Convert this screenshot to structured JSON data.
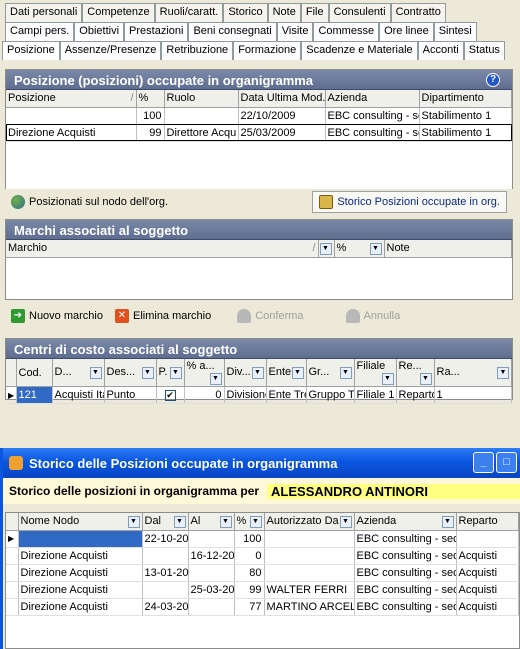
{
  "tabs": {
    "row1": [
      "Dati personali",
      "Competenze",
      "Ruoli/caratt.",
      "Storico",
      "Note",
      "File",
      "Consulenti",
      "Contratto"
    ],
    "row2": [
      "Campi pers.",
      "Obiettivi",
      "Prestazioni",
      "Beni consegnati",
      "Visite",
      "Commesse",
      "Ore linee",
      "Sintesi"
    ],
    "row3": [
      "Posizione",
      "Assenze/Presenze",
      "Retribuzione",
      "Formazione",
      "Scadenze e Materiale",
      "Acconti",
      "Status"
    ]
  },
  "positions": {
    "title": "Posizione (posizioni) occupate in organigramma",
    "help_icon": "question-icon",
    "columns": [
      "Posizione",
      "%",
      "Ruolo",
      "Data Ultima Mod.",
      "Azienda",
      "Dipartimento"
    ],
    "rows": [
      [
        "",
        "100",
        "",
        "22/10/2009",
        "EBC consulting - se",
        "Stabilimento 1"
      ],
      [
        "Direzione Acquisti",
        "99",
        "Direttore Acqu",
        "25/03/2009",
        "EBC consulting - se",
        "Stabilimento 1"
      ]
    ],
    "btn_position": "Posizionati sul nodo dell'org.",
    "btn_history": "Storico Posizioni occupate in org."
  },
  "brands": {
    "title": "Marchi associati al soggetto",
    "columns": [
      "Marchio",
      "%",
      "Note"
    ],
    "btn_new": "Nuovo marchio",
    "btn_delete": "Elimina marchio",
    "btn_confirm": "Conferma",
    "btn_cancel": "Annulla"
  },
  "costcenters": {
    "title": "Centri di costo associati al soggetto",
    "columns": [
      "Cod.",
      "D...",
      "Des...",
      "P.",
      "% a...",
      "Div...",
      "Ente",
      "Gr...",
      "Filiale",
      "Re...",
      "Ra..."
    ],
    "row": [
      "121",
      "Acquisti Ita",
      "Punto",
      "",
      "0",
      "Divisione",
      "Ente Tre",
      "Gruppo T",
      "Filiale 1",
      "Reparto '",
      "1"
    ]
  },
  "history_window": {
    "title": "Storico delle Posizioni occupate in organigramma",
    "label": "Storico delle posizioni in organigramma per",
    "person": "ALESSANDRO ANTINORI",
    "columns": [
      "Nome Nodo",
      "Dal",
      "Al",
      "%",
      "Autorizzato Da",
      "Azienda",
      "Reparto"
    ],
    "rows": [
      [
        "",
        "22-10-20",
        "",
        "100",
        "",
        "EBC consulting - sede",
        ""
      ],
      [
        "Direzione Acquisti",
        "",
        "16-12-20",
        "0",
        "",
        "EBC consulting - sede",
        "Acquisti"
      ],
      [
        "Direzione Acquisti",
        "13-01-20",
        "",
        "80",
        "",
        "EBC consulting - sede",
        "Acquisti"
      ],
      [
        "Direzione Acquisti",
        "",
        "25-03-20",
        "99",
        "WALTER FERRI",
        "EBC consulting - sede",
        "Acquisti"
      ],
      [
        "Direzione Acquisti",
        "24-03-20",
        "",
        "77",
        "MARTINO ARCEL",
        "EBC consulting - sede",
        "Acquisti"
      ]
    ]
  }
}
